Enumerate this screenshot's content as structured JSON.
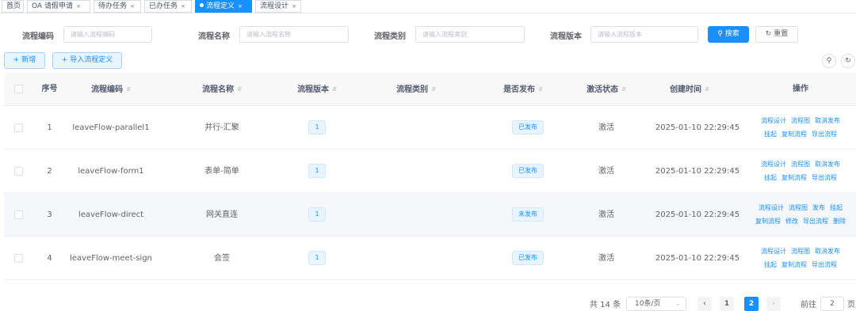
{
  "tabs": [
    {
      "label": "首页",
      "closable": false
    },
    {
      "label": "OA 请假申请",
      "closable": true
    },
    {
      "label": "待办任务",
      "closable": true
    },
    {
      "label": "已办任务",
      "closable": true
    },
    {
      "label": "流程定义",
      "closable": true,
      "active": true
    },
    {
      "label": "流程设计",
      "closable": true
    }
  ],
  "close_glyph": "×",
  "search": {
    "code_label": "流程编码",
    "code_placeholder": "请输入流程编码",
    "name_label": "流程名称",
    "name_placeholder": "请输入流程名称",
    "category_label": "流程类别",
    "category_placeholder": "请输入流程类别",
    "version_label": "流程版本",
    "version_placeholder": "请输入流程版本",
    "search_button": "搜索",
    "reset_button": "重置"
  },
  "toolbar": {
    "add_button": "新增",
    "import_button": "导入流程定义"
  },
  "table": {
    "headers": {
      "index": "序号",
      "code": "流程编码",
      "name": "流程名称",
      "version": "流程版本",
      "category": "流程类别",
      "published": "是否发布",
      "active": "激活状态",
      "created": "创建时间",
      "actions": "操作"
    },
    "rows": [
      {
        "index": "1",
        "code": "leaveFlow-parallel1",
        "name": "并行-汇聚",
        "version": "1",
        "category": "",
        "published": "已发布",
        "active": "激活",
        "created": "2025-01-10 22:29:45",
        "actions": [
          [
            "流程设计",
            "流程图",
            "取消发布"
          ],
          [
            "挂起",
            "复制流程",
            "导出流程"
          ]
        ]
      },
      {
        "index": "2",
        "code": "leaveFlow-form1",
        "name": "表单-简单",
        "version": "1",
        "category": "",
        "published": "已发布",
        "active": "激活",
        "created": "2025-01-10 22:29:45",
        "actions": [
          [
            "流程设计",
            "流程图",
            "取消发布"
          ],
          [
            "挂起",
            "复制流程",
            "导出流程"
          ]
        ]
      },
      {
        "index": "3",
        "code": "leaveFlow-direct",
        "name": "网关直连",
        "version": "1",
        "category": "",
        "published": "未发布",
        "active": "激活",
        "created": "2025-01-10 22:29:45",
        "actions": [
          [
            "流程设计",
            "流程图",
            "发布",
            "挂起"
          ],
          [
            "复制流程",
            "修改",
            "导出流程",
            "删除"
          ]
        ]
      },
      {
        "index": "4",
        "code": "leaveFlow-meet-sign",
        "name": "会签",
        "version": "1",
        "category": "",
        "published": "已发布",
        "active": "激活",
        "created": "2025-01-10 22:29:45",
        "actions": [
          [
            "流程设计",
            "流程图",
            "取消发布"
          ],
          [
            "挂起",
            "复制流程",
            "导出流程"
          ]
        ]
      }
    ]
  },
  "pagination": {
    "total_text": "共 14 条",
    "page_size": "10条/页",
    "pages": [
      "1",
      "2"
    ],
    "current_page": "2",
    "goto_label": "前往",
    "goto_value": "2",
    "page_suffix": "页"
  },
  "colors": {
    "primary": "#1890ff"
  }
}
